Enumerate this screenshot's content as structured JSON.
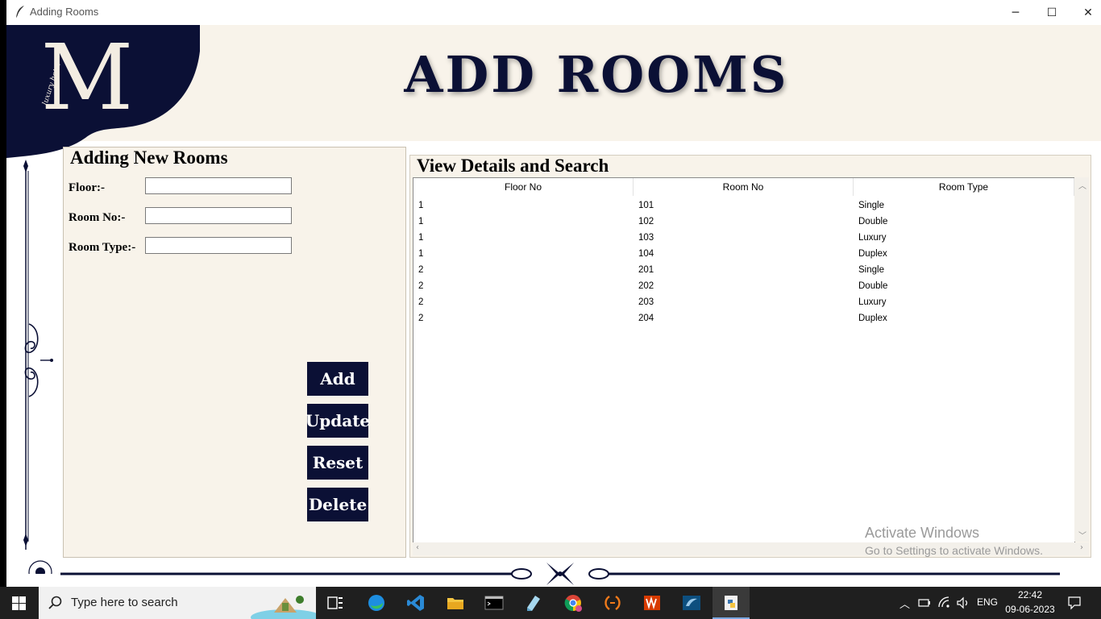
{
  "window": {
    "title": "Adding Rooms",
    "controls": {
      "minimize": "─",
      "maximize": "☐",
      "close": "✕"
    }
  },
  "banner": {
    "title": "ADD ROOMS"
  },
  "logo": {
    "monogram": "M",
    "script_text": "luxury hotel"
  },
  "add_panel": {
    "legend": "Adding New Rooms",
    "fields": [
      {
        "label": "Floor:-",
        "value": ""
      },
      {
        "label": "Room No:-",
        "value": ""
      },
      {
        "label": "Room Type:-",
        "value": ""
      }
    ],
    "buttons": [
      "Add",
      "Update",
      "Reset",
      "Delete"
    ]
  },
  "view_panel": {
    "legend": "View Details and Search",
    "columns": [
      "Floor No",
      "Room No",
      "Room Type"
    ],
    "rows": [
      [
        "1",
        "101",
        "Single"
      ],
      [
        "1",
        "102",
        "Double"
      ],
      [
        "1",
        "103",
        "Luxury"
      ],
      [
        "1",
        "104",
        "Duplex"
      ],
      [
        "2",
        "201",
        "Single"
      ],
      [
        "2",
        "202",
        "Double"
      ],
      [
        "2",
        "203",
        "Luxury"
      ],
      [
        "2",
        "204",
        "Duplex"
      ]
    ]
  },
  "watermark": {
    "line1": "Activate Windows",
    "line2": "Go to Settings to activate Windows."
  },
  "taskbar": {
    "search_placeholder": "Type here to search",
    "apps": [
      "task-view",
      "edge",
      "vscode",
      "file-explorer",
      "terminal",
      "notepad",
      "chrome",
      "eclipse",
      "office",
      "mysql-workbench",
      "python-idle"
    ],
    "language": "ENG",
    "time": "22:42",
    "date": "09-06-2023"
  },
  "colors": {
    "navy": "#0b1035",
    "cream": "#f8f3ea",
    "taskbar": "#1f1f1f"
  }
}
